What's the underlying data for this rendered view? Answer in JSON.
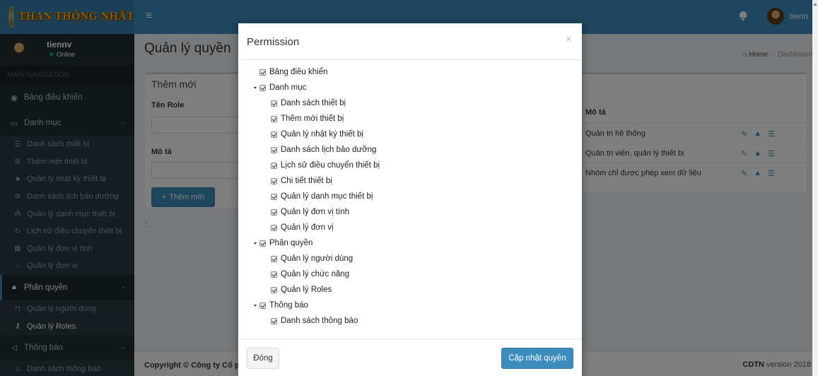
{
  "header": {
    "logo_text": "THAN THÔNG NHẤT",
    "menu_icon": "hamburger-icon",
    "username": "tienn"
  },
  "sidebar": {
    "user": {
      "name": "tiennv",
      "status": "Online"
    },
    "section_header": "MAIN NAVIGATION",
    "items": [
      {
        "label": "Bảng điều khiển",
        "icon": "dashboard-icon"
      },
      {
        "label": "Danh mục",
        "icon": "laptop-icon",
        "expanded": true,
        "children": [
          {
            "label": "Danh sách thiết bị",
            "icon": "list-icon"
          },
          {
            "label": "Thêm mới thiết bị",
            "icon": "plus-square-icon"
          },
          {
            "label": "Quản lý nhật ký thiết bị",
            "icon": "book-icon"
          },
          {
            "label": "Danh sách lịch bảo dưỡng",
            "icon": "cogs-icon"
          },
          {
            "label": "Quản lý danh mục thiết bị",
            "icon": "sitemap-icon"
          },
          {
            "label": "Lịch sử điều chuyển thiết bị",
            "icon": "refresh-icon"
          },
          {
            "label": "Quản lý đơn vị tính",
            "icon": "calculator-icon"
          },
          {
            "label": "Quản lý đơn vị",
            "icon": "bank-icon"
          }
        ]
      },
      {
        "label": "Phân quyền",
        "icon": "lock-icon",
        "expanded": true,
        "children": [
          {
            "label": "Quản lý người dùng",
            "icon": "lock-outline-icon"
          },
          {
            "label": "Quản lý Roles",
            "icon": "key-icon",
            "current": true
          }
        ]
      },
      {
        "label": "Thông báo",
        "icon": "bullhorn-icon",
        "expanded": true,
        "children": [
          {
            "label": "Danh sách thông báo",
            "icon": "bell-icon"
          }
        ]
      }
    ]
  },
  "content": {
    "page_title": "Quản lý quyền",
    "breadcrumb": [
      "Home",
      "Dashboard"
    ],
    "form": {
      "title": "Thêm mới",
      "role_label": "Tên Role",
      "desc_label": "Mô tả",
      "add_button": "Thêm mới"
    },
    "colon": ":",
    "table": {
      "header": "Mô tả",
      "rows": [
        "Quản trị hệ thống",
        "Quản trị viên, quản lý thiết bị",
        "Nhóm chỉ được phép xem dữ liệu"
      ]
    }
  },
  "footer": {
    "copyright": "Copyright © Công ty Cổ phần",
    "version_label": "CDTN",
    "version_text": "version 2018"
  },
  "modal": {
    "title": "Permission",
    "close_symbol": "×",
    "tree": [
      {
        "label": "Bảng điều khiển",
        "level": 0,
        "toggle": false
      },
      {
        "label": "Danh mục",
        "level": 0,
        "toggle": true
      },
      {
        "label": "Danh sách thiết bị",
        "level": 1
      },
      {
        "label": "Thêm mới thiết bị",
        "level": 1
      },
      {
        "label": "Quản lý nhật ký thiết bị",
        "level": 1
      },
      {
        "label": "Danh sách lịch bảo dưỡng",
        "level": 1
      },
      {
        "label": "Lịch sử điều chuyển thiết bị",
        "level": 1
      },
      {
        "label": "Chi tiết thiết bị",
        "level": 1
      },
      {
        "label": "Quản lý danh mục thiết bị",
        "level": 1
      },
      {
        "label": "Quản lý đơn vị tính",
        "level": 1
      },
      {
        "label": "Quản lý đơn vị",
        "level": 1
      },
      {
        "label": "Phân quyền",
        "level": 0,
        "toggle": true
      },
      {
        "label": "Quản lý người dùng",
        "level": 1
      },
      {
        "label": "Quản lý chức năng",
        "level": 1
      },
      {
        "label": "Quản lý Roles",
        "level": 1
      },
      {
        "label": "Thông báo",
        "level": 0,
        "toggle": true
      },
      {
        "label": "Danh sách thông báo",
        "level": 1
      }
    ],
    "close_button": "Đóng",
    "update_button": "Cập nhật quyền"
  },
  "colors": {
    "header_bg": "#3c8dbc",
    "sidebar_bg": "#222d32",
    "primary": "#3c8dbc",
    "overlay": "rgba(0,0,0,0.5)"
  }
}
